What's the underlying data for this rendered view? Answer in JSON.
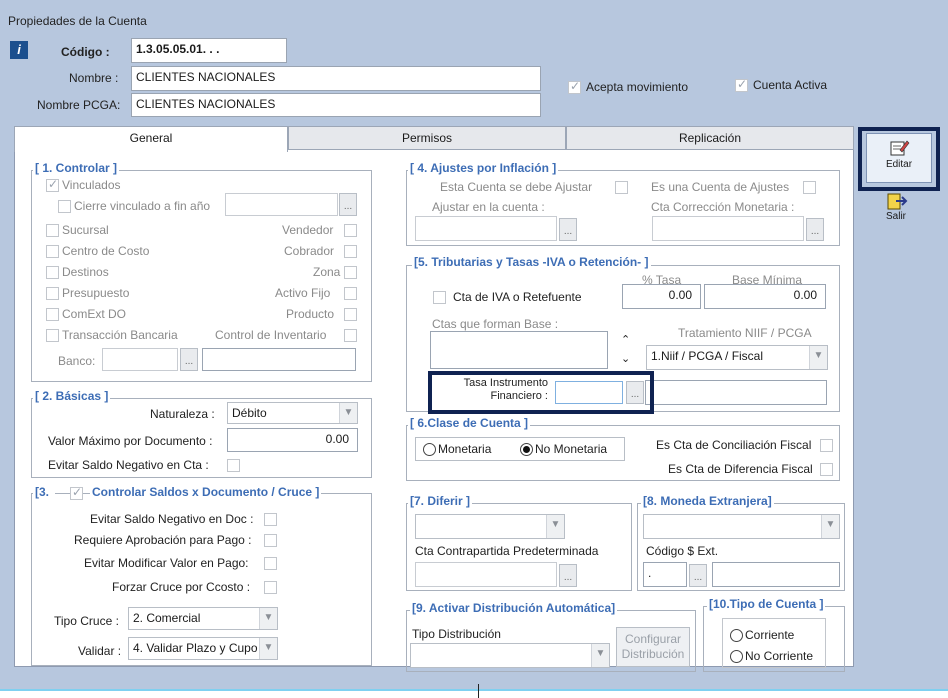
{
  "window_title": "Propiedades de la Cuenta",
  "header": {
    "codigo_label": "Código :",
    "codigo_value": "1.3.05.05.01. . .",
    "nombre_label": "Nombre :",
    "nombre_value": "CLIENTES NACIONALES",
    "nombre_pcga_label": "Nombre PCGA:",
    "nombre_pcga_value": "CLIENTES NACIONALES",
    "acepta_movimiento": "Acepta movimiento",
    "cuenta_activa": "Cuenta Activa"
  },
  "tabs": [
    "General",
    "Permisos",
    "Replicación"
  ],
  "side_buttons": {
    "editar": "Editar",
    "salir": "Salir"
  },
  "g1": {
    "title": "[ 1. Controlar ]",
    "vinculados": "Vinculados",
    "cierre": "Cierre vinculado a fin año",
    "sucursal": "Sucursal",
    "centro_costo": "Centro de Costo",
    "destinos": "Destinos",
    "presupuesto": "Presupuesto",
    "comext": "ComExt DO",
    "transaccion": "Transacción Bancaria",
    "vendedor": "Vendedor",
    "cobrador": "Cobrador",
    "zona": "Zona",
    "activo_fijo": "Activo Fijo",
    "producto": "Producto",
    "control_inventario": "Control de Inventario",
    "banco": "Banco:",
    "dots": "..."
  },
  "g2": {
    "title": "[ 2. Básicas ]",
    "naturaleza_label": "Naturaleza :",
    "naturaleza_value": "Débito",
    "valor_max_label": "Valor Máximo por Documento :",
    "valor_max_value": "0.00",
    "evitar_saldo_label": "Evitar Saldo Negativo en Cta :"
  },
  "g3": {
    "title_prefix": "[3.",
    "title": "Controlar Saldos x Documento / Cruce ]",
    "evitar_doc": "Evitar Saldo Negativo en Doc :",
    "requiere_aprob": "Requiere Aprobación para Pago :",
    "evitar_modificar": "Evitar Modificar Valor en Pago:",
    "forzar_cruce": "Forzar Cruce por Ccosto :",
    "tipo_cruce_label": "Tipo Cruce :",
    "tipo_cruce_value": "2. Comercial",
    "validar_label": "Validar :",
    "validar_value": "4. Validar Plazo y Cupo"
  },
  "g4": {
    "title": "[ 4. Ajustes por Inflación ]",
    "debe_ajustar": "Esta Cuenta  se debe Ajustar",
    "es_cuenta_ajustes": "Es una Cuenta de Ajustes",
    "ajustar_en": "Ajustar en la cuenta :",
    "cta_correccion": "Cta Corrección Monetaria :"
  },
  "g5": {
    "title": "[5. Tributarias y Tasas  -IVA o Retención- ]",
    "pct_tasa_label": "% Tasa",
    "base_minima_label": "Base Mínima",
    "cta_iva": "Cta de IVA o Retefuente",
    "tasa_value": "0.00",
    "base_value": "0.00",
    "ctas_base": "Ctas que forman Base :",
    "tratamiento_label": "Tratamiento NIIF / PCGA",
    "tratamiento_value": "1.Niif / PCGA / Fiscal",
    "tasa_instrumento_1": "Tasa Instrumento",
    "tasa_instrumento_2": "Financiero :"
  },
  "g6": {
    "title": "[ 6.Clase de Cuenta ]",
    "monetaria": "Monetaria",
    "no_monetaria": "No Monetaria",
    "conciliacion": "Es Cta de Conciliación Fiscal",
    "diferencia": "Es Cta de Diferencia Fiscal"
  },
  "g7": {
    "title": "[7. Diferir ]",
    "contrapartida": "Cta Contrapartida Predeterminada"
  },
  "g8": {
    "title": "[8. Moneda Extranjera]",
    "codigo_ext": "Código $ Ext.",
    "codigo_value": "."
  },
  "g9": {
    "title": "[9. Activar Distribución Automática]",
    "tipo_distribucion": "Tipo Distribución",
    "configurar_1": "Configurar",
    "configurar_2": "Distribución"
  },
  "g10": {
    "title": "[10.Tipo de Cuenta ]",
    "corriente": "Corriente",
    "no_corriente": "No Corriente"
  }
}
